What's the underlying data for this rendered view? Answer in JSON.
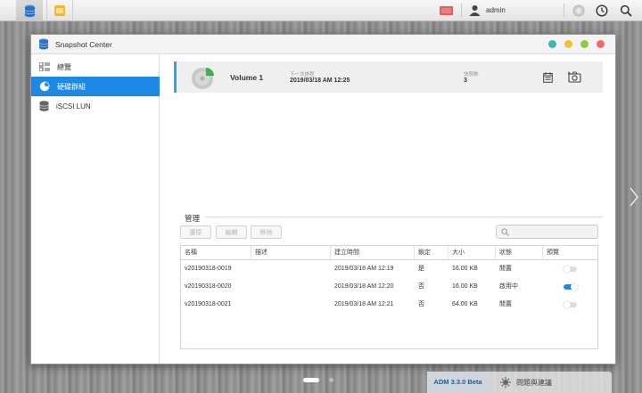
{
  "colors": {
    "accent": "#1e88e5",
    "card_border": "#35a5e0",
    "win_teal": "#3bb6b0",
    "win_yellow": "#f2c335",
    "win_green": "#98c83c",
    "win_red": "#ef6b6b",
    "toggle_on": "#1e88e5"
  },
  "topbar": {
    "user": "admin",
    "icons": [
      "storage-app-icon",
      "folder-app-icon",
      "network-alert-icon",
      "user-icon",
      "status-icon",
      "clock-icon",
      "search-icon"
    ]
  },
  "window": {
    "title": "Snapshot Center"
  },
  "sidebar": {
    "items": [
      {
        "label": "總覽",
        "icon": "overview-icon"
      },
      {
        "label": "硬碟群組",
        "icon": "volume-icon"
      },
      {
        "label": "iSCSI LUN",
        "icon": "lun-icon"
      }
    ]
  },
  "volume": {
    "name": "Volume 1",
    "next_label": "下一次排程",
    "next_value": "2019/03/18 AM 12:25",
    "count_label": "快照數:",
    "count_value": "3"
  },
  "management": {
    "title": "管理",
    "buttons": [
      "還原",
      "編輯",
      "移除"
    ],
    "search_placeholder": "",
    "columns": [
      "名稱",
      "描述",
      "建立時間",
      "鎖定",
      "大小",
      "狀態",
      "預覽"
    ],
    "rows": [
      {
        "name": "v20190318-0019",
        "desc": "",
        "created": "2019/03/18 AM 12:19",
        "locked": "是",
        "size": "16.00 KB",
        "status": "閒置",
        "preview": false
      },
      {
        "name": "v20190318-0020",
        "desc": "",
        "created": "2019/03/18 AM 12:20",
        "locked": "否",
        "size": "16.00 KB",
        "status": "啟用中",
        "preview": true
      },
      {
        "name": "v20190318-0021",
        "desc": "",
        "created": "2019/03/18 AM 12:21",
        "locked": "否",
        "size": "64.00 KB",
        "status": "閒置",
        "preview": false
      }
    ]
  },
  "footer": {
    "version": "ADM 3.3.0 Beta",
    "help": "問題與建議"
  }
}
